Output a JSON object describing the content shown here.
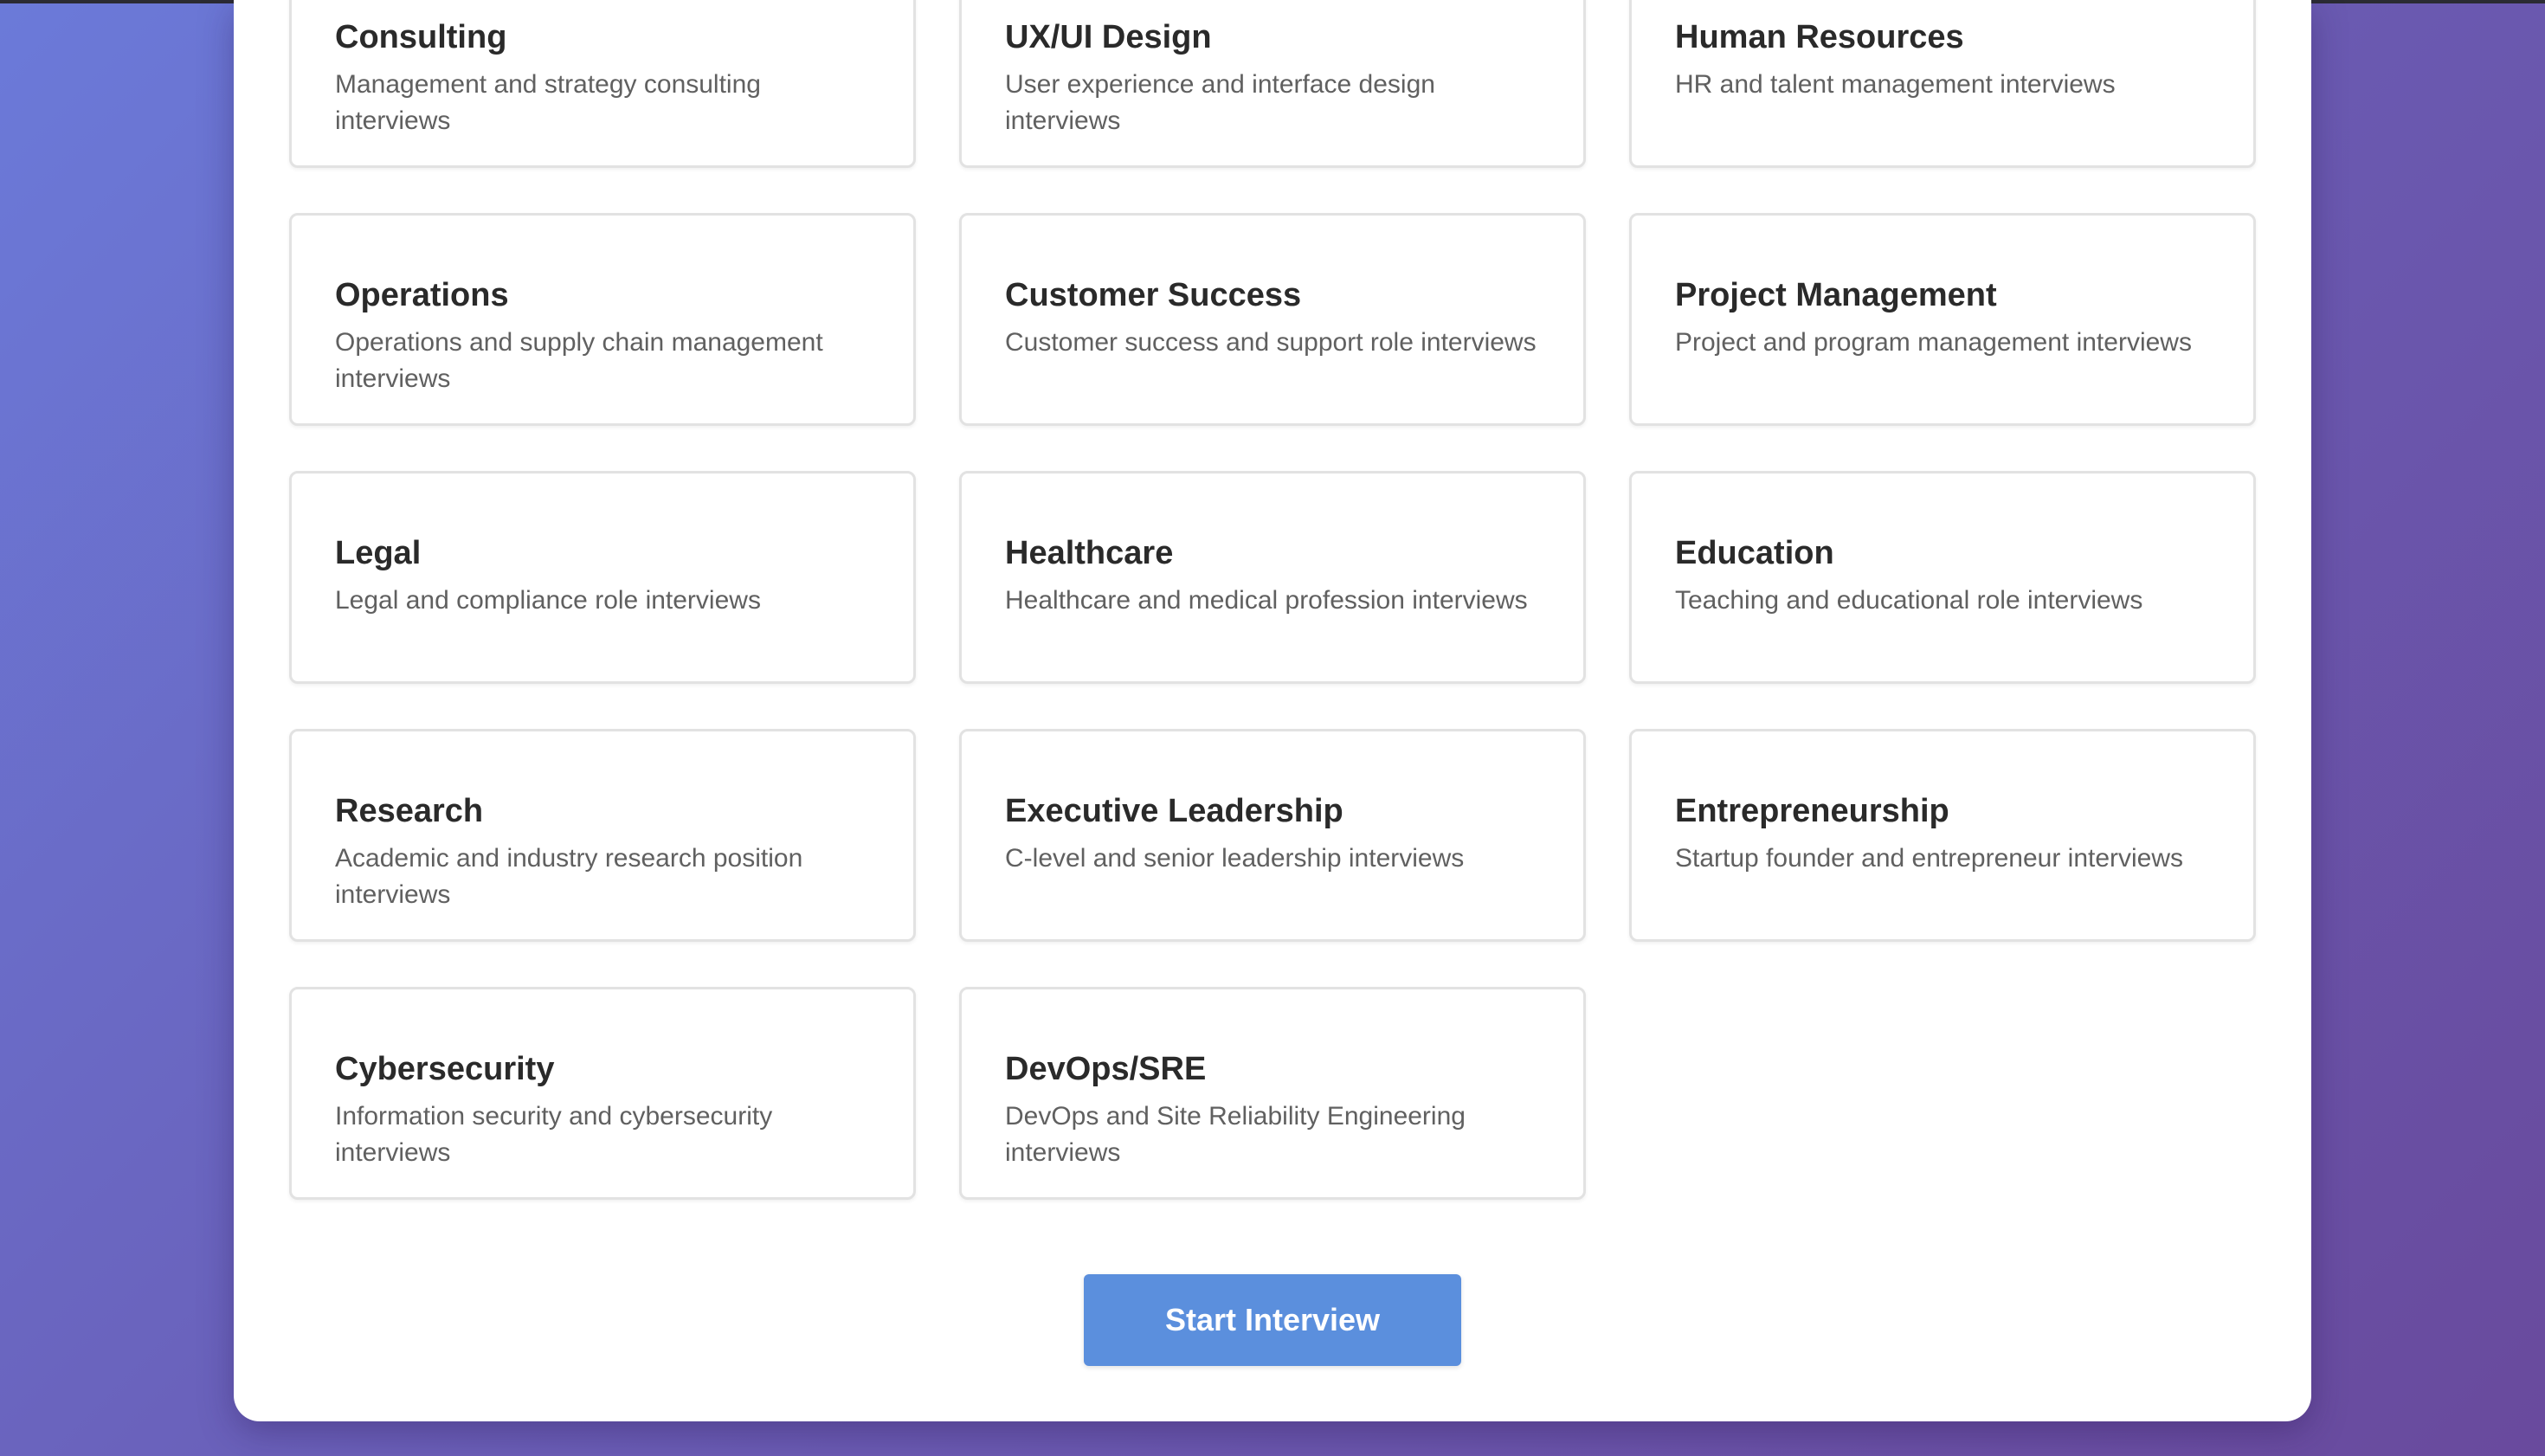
{
  "colors": {
    "background_start": "#6b7ad9",
    "background_end": "#694a9d",
    "panel": "#ffffff",
    "card_border": "#e2e2e2",
    "accent_button": "#5b8fdd"
  },
  "interview_types": [
    {
      "title": "Consulting",
      "description": "Management and strategy consulting interviews"
    },
    {
      "title": "UX/UI Design",
      "description": "User experience and interface design interviews"
    },
    {
      "title": "Human Resources",
      "description": "HR and talent management interviews"
    },
    {
      "title": "Operations",
      "description": "Operations and supply chain management interviews"
    },
    {
      "title": "Customer Success",
      "description": "Customer success and support role interviews"
    },
    {
      "title": "Project Management",
      "description": "Project and program management interviews"
    },
    {
      "title": "Legal",
      "description": "Legal and compliance role interviews"
    },
    {
      "title": "Healthcare",
      "description": "Healthcare and medical profession interviews"
    },
    {
      "title": "Education",
      "description": "Teaching and educational role interviews"
    },
    {
      "title": "Research",
      "description": "Academic and industry research position interviews"
    },
    {
      "title": "Executive Leadership",
      "description": "C-level and senior leadership interviews"
    },
    {
      "title": "Entrepreneurship",
      "description": "Startup founder and entrepreneur interviews"
    },
    {
      "title": "Cybersecurity",
      "description": "Information security and cybersecurity interviews"
    },
    {
      "title": "DevOps/SRE",
      "description": "DevOps and Site Reliability Engineering interviews"
    }
  ],
  "actions": {
    "start_label": "Start Interview"
  }
}
